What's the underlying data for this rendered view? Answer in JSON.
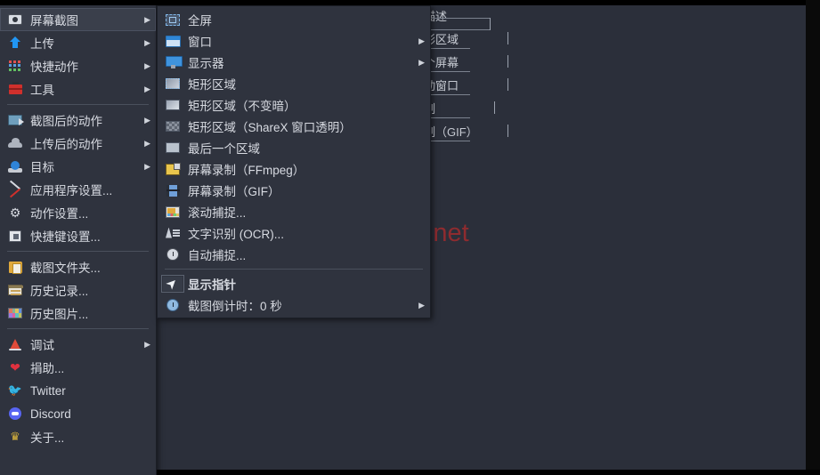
{
  "background": {
    "watermark": "www.szyixin.net",
    "watermark_color": "#8e2b2f",
    "table_rows": [
      {
        "text": "描述"
      },
      {
        "text": "形区域"
      },
      {
        "text": "个屏幕"
      },
      {
        "text": "动窗口"
      },
      {
        "text": "制"
      },
      {
        "text": "制（GIF）"
      }
    ]
  },
  "main_menu": {
    "items": [
      {
        "id": "screenshot",
        "label": "屏幕截图",
        "icon": "camera-icon",
        "arrow": "▶",
        "highlighted": true
      },
      {
        "id": "upload",
        "label": "上传",
        "icon": "upload-arrow-icon",
        "arrow": "▶"
      },
      {
        "id": "quick-actions",
        "label": "快捷动作",
        "icon": "grid-dots-icon",
        "arrow": "▶"
      },
      {
        "id": "tools",
        "label": "工具",
        "icon": "toolbox-icon",
        "arrow": "▶"
      },
      {
        "id": "sep1",
        "type": "separator"
      },
      {
        "id": "after-capture",
        "label": "截图后的动作",
        "icon": "after-capture-icon",
        "arrow": "▶"
      },
      {
        "id": "after-upload",
        "label": "上传后的动作",
        "icon": "cloud-icon",
        "arrow": "▶"
      },
      {
        "id": "destination",
        "label": "目标",
        "icon": "destination-icon",
        "arrow": "▶"
      },
      {
        "id": "app-settings",
        "label": "应用程序设置...",
        "icon": "wrench-icon",
        "arrow": ""
      },
      {
        "id": "task-settings",
        "label": "动作设置...",
        "icon": "gear-icon",
        "arrow": ""
      },
      {
        "id": "hotkey-settings",
        "label": "快捷键设置...",
        "icon": "keyboard-icon",
        "arrow": ""
      },
      {
        "id": "sep2",
        "type": "separator"
      },
      {
        "id": "screenshots-folder",
        "label": "截图文件夹...",
        "icon": "folder-icon",
        "arrow": ""
      },
      {
        "id": "history",
        "label": "历史记录...",
        "icon": "history-icon",
        "arrow": ""
      },
      {
        "id": "image-history",
        "label": "历史图片...",
        "icon": "image-history-icon",
        "arrow": ""
      },
      {
        "id": "sep3",
        "type": "separator"
      },
      {
        "id": "debug",
        "label": "调试",
        "icon": "cone-icon",
        "arrow": "▶"
      },
      {
        "id": "donate",
        "label": "捐助...",
        "icon": "heart-icon",
        "arrow": ""
      },
      {
        "id": "twitter",
        "label": "Twitter",
        "icon": "twitter-bird-icon",
        "arrow": ""
      },
      {
        "id": "discord",
        "label": "Discord",
        "icon": "discord-icon",
        "arrow": ""
      },
      {
        "id": "about",
        "label": "关于...",
        "icon": "crown-icon",
        "arrow": ""
      }
    ]
  },
  "sub_menu": {
    "items": [
      {
        "id": "fullscreen",
        "label": "全屏",
        "icon": "fullscreen-icon",
        "arrow": ""
      },
      {
        "id": "window",
        "label": "窗口",
        "icon": "window-icon",
        "arrow": "▶"
      },
      {
        "id": "monitor",
        "label": "显示器",
        "icon": "monitor-icon",
        "arrow": "▶"
      },
      {
        "id": "region",
        "label": "矩形区域",
        "icon": "region-icon",
        "arrow": ""
      },
      {
        "id": "region-light",
        "label": "矩形区域（不变暗）",
        "icon": "region-light-icon",
        "arrow": ""
      },
      {
        "id": "region-transp",
        "label": "矩形区域（ShareX 窗口透明）",
        "icon": "region-transparent-icon",
        "arrow": ""
      },
      {
        "id": "last-region",
        "label": "最后一个区域",
        "icon": "last-region-icon",
        "arrow": ""
      },
      {
        "id": "record-ffmpeg",
        "label": "屏幕录制（FFmpeg）",
        "icon": "record-ffmpeg-icon",
        "arrow": ""
      },
      {
        "id": "record-gif",
        "label": "屏幕录制（GIF）",
        "icon": "record-gif-icon",
        "arrow": ""
      },
      {
        "id": "scrolling",
        "label": "滚动捕捉...",
        "icon": "scrolling-capture-icon",
        "arrow": ""
      },
      {
        "id": "ocr",
        "label": "文字识别 (OCR)...",
        "icon": "ocr-icon",
        "arrow": ""
      },
      {
        "id": "auto-capture",
        "label": "自动捕捉...",
        "icon": "auto-capture-icon",
        "arrow": ""
      },
      {
        "id": "sep1",
        "type": "separator"
      },
      {
        "id": "show-cursor",
        "label": "显示指针",
        "icon": "cursor-icon",
        "arrow": "",
        "bold": true
      },
      {
        "id": "capture-delay",
        "label": "截图倒计时：0 秒",
        "icon": "delay-clock-icon",
        "arrow": "▶"
      }
    ]
  }
}
